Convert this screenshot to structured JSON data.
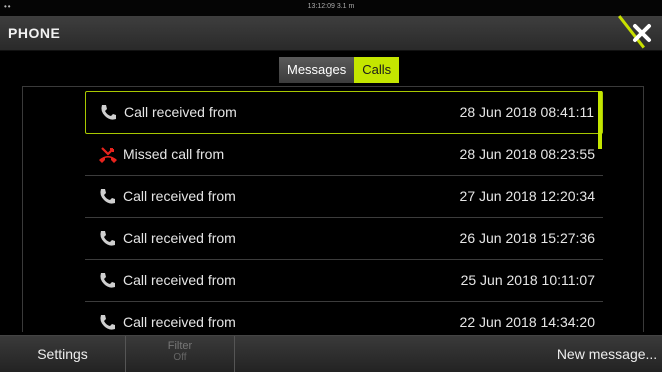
{
  "status": {
    "time": "13:12:09  3.1 m"
  },
  "header": {
    "title": "PHONE"
  },
  "tabs": [
    {
      "label": "Messages",
      "active": false
    },
    {
      "label": "Calls",
      "active": true
    }
  ],
  "calls": [
    {
      "label": "Call received from",
      "datetime": "28 Jun 2018 08:41:11",
      "type": "received",
      "icon": "phone-icon"
    },
    {
      "label": "Missed call from",
      "datetime": "28 Jun 2018 08:23:55",
      "type": "missed",
      "icon": "missed-call-icon"
    },
    {
      "label": "Call received from",
      "datetime": "27 Jun 2018 12:20:34",
      "type": "received",
      "icon": "phone-icon"
    },
    {
      "label": "Call received from",
      "datetime": "26 Jun 2018 15:27:36",
      "type": "received",
      "icon": "phone-icon"
    },
    {
      "label": "Call received from",
      "datetime": "25 Jun 2018 10:11:07",
      "type": "received",
      "icon": "phone-icon"
    },
    {
      "label": "Call received from",
      "datetime": "22 Jun 2018 14:34:20",
      "type": "received",
      "icon": "phone-icon"
    }
  ],
  "bottom": {
    "settings": "Settings",
    "filter": "Filter",
    "filter_state": "Off",
    "new_message": "New message..."
  },
  "colors": {
    "accent": "#c4e600",
    "missed": "#e8231d"
  }
}
